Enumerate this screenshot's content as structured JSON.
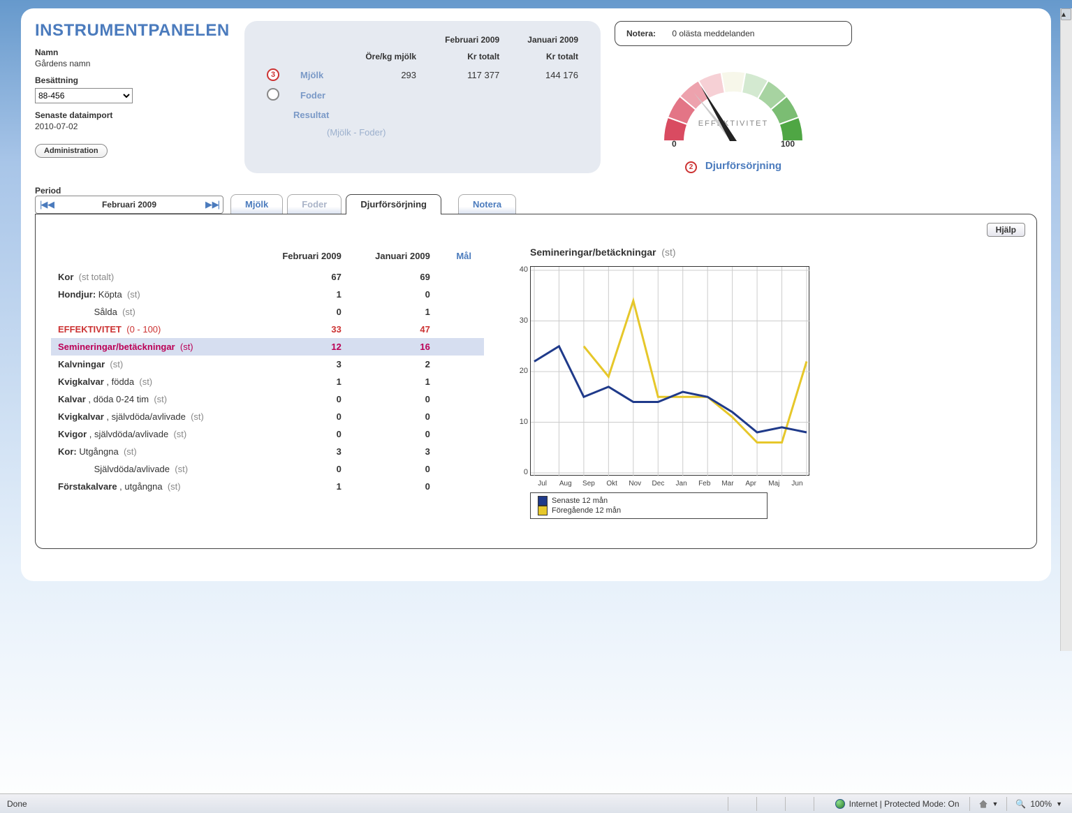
{
  "app": {
    "title": "INSTRUMENTPANELEN"
  },
  "fields": {
    "namn_label": "Namn",
    "namn_value": "Gårdens namn",
    "besattning_label": "Besättning",
    "besattning_value": "88-456",
    "import_label": "Senaste dataimport",
    "import_value": "2010-07-02",
    "admin_button": "Administration",
    "period_label": "Period",
    "period_value": "Februari 2009"
  },
  "summary": {
    "col1_head": "Öre/kg mjölk",
    "col2_top": "Februari 2009",
    "col2_head": "Kr totalt",
    "col3_top": "Januari 2009",
    "col3_head": "Kr totalt",
    "rows": {
      "mjolk": {
        "badge": "3",
        "label": "Mjölk",
        "c1": "293",
        "c2": "117 377",
        "c3": "144 176"
      },
      "foder": {
        "label": "Foder"
      },
      "resultat": {
        "label": "Resultat",
        "sub": "(Mjölk - Foder)"
      }
    }
  },
  "notera": {
    "label": "Notera:",
    "msg": "0 olästa meddelanden"
  },
  "gauge": {
    "label_text": "EFFEKTIVITET",
    "min": "0",
    "max": "100",
    "badge": "2",
    "link": "Djurförsörjning",
    "colors": {
      "seg_red4": "#d94b61",
      "seg_red3": "#e37586",
      "seg_red2": "#eda2ad",
      "seg_red1": "#f6d0d5",
      "seg_mid": "#f7f7ea",
      "seg_grn1": "#d3e9d0",
      "seg_grn2": "#a7d3a1",
      "seg_grn3": "#7bbd73",
      "seg_grn4": "#4fa644"
    }
  },
  "tabs": {
    "mjolk": "Mjölk",
    "foder": "Foder",
    "djur": "Djurförsörjning",
    "notera": "Notera"
  },
  "help_btn": "Hjälp",
  "table": {
    "headers": {
      "c1": "Februari 2009",
      "c2": "Januari 2009",
      "c3": "Mål"
    },
    "rows": [
      {
        "label_b": "Kor",
        "label_g": "(st totalt)",
        "c1": "67",
        "c2": "69"
      },
      {
        "label_b": "Hondjur:",
        "label_m": "Köpta",
        "label_g": "(st)",
        "c1": "1",
        "c2": "0"
      },
      {
        "indent": true,
        "label_m": "Sålda",
        "label_g": "(st)",
        "c1": "0",
        "c2": "1"
      },
      {
        "cls": "eff",
        "label_b": "EFFEKTIVITET",
        "label_g": "(0 - 100)",
        "c1": "33",
        "c2": "47"
      },
      {
        "cls": "sel",
        "label_b": "Semineringar/betäckningar",
        "label_g": "(st)",
        "c1": "12",
        "c2": "16"
      },
      {
        "label_b": "Kalvningar",
        "label_g": "(st)",
        "c1": "3",
        "c2": "2"
      },
      {
        "label_b": "Kvigkalvar",
        "label_m": ", födda",
        "label_g": "(st)",
        "c1": "1",
        "c2": "1"
      },
      {
        "label_b": "Kalvar",
        "label_m": ", döda 0-24 tim",
        "label_g": "(st)",
        "c1": "0",
        "c2": "0"
      },
      {
        "label_b": "Kvigkalvar",
        "label_m": ", självdöda/avlivade",
        "label_g": "(st)",
        "c1": "0",
        "c2": "0"
      },
      {
        "label_b": "Kvigor",
        "label_m": ", självdöda/avlivade",
        "label_g": "(st)",
        "c1": "0",
        "c2": "0"
      },
      {
        "label_b": "Kor:",
        "label_m": "Utgångna",
        "label_g": "(st)",
        "c1": "3",
        "c2": "3"
      },
      {
        "indent": true,
        "label_m": "Självdöda/avlivade",
        "label_g": "(st)",
        "c1": "0",
        "c2": "0"
      },
      {
        "label_b": "Förstakalvare",
        "label_m": ", utgångna",
        "label_g": "(st)",
        "c1": "1",
        "c2": "0"
      }
    ]
  },
  "chart_data": {
    "type": "line",
    "title_b": "Semineringar/betäckningar",
    "title_g": "(st)",
    "categories": [
      "Jul",
      "Aug",
      "Sep",
      "Okt",
      "Nov",
      "Dec",
      "Jan",
      "Feb",
      "Mar",
      "Apr",
      "Maj",
      "Jun"
    ],
    "ylim": [
      0,
      40
    ],
    "yticks": [
      0,
      10,
      20,
      30,
      40
    ],
    "series": [
      {
        "name": "Senaste 12 mån",
        "color": "#1f3a8a",
        "values": [
          22,
          25,
          15,
          17,
          14,
          14,
          16,
          15,
          12,
          8,
          9,
          8
        ]
      },
      {
        "name": "Föregående 12 mån",
        "color": "#e6c72a",
        "values": [
          null,
          null,
          25,
          19,
          34,
          15,
          15,
          15,
          11,
          6,
          6,
          22
        ]
      }
    ]
  },
  "statusbar": {
    "done": "Done",
    "ie": "Internet | Protected Mode: On",
    "zoom": "100%"
  }
}
